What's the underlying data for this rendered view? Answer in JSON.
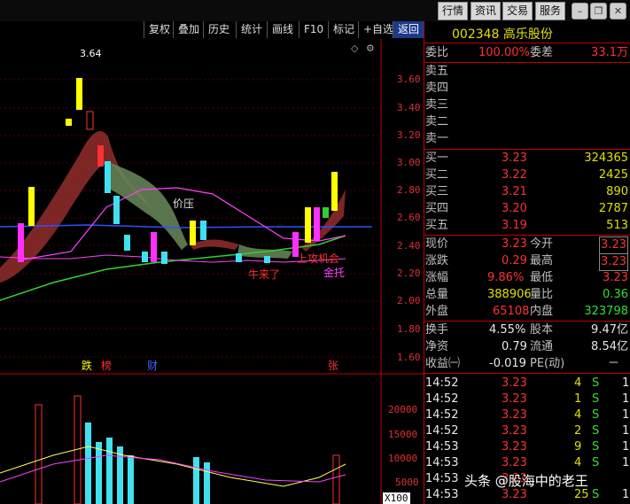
{
  "topbar": {
    "buttons": [
      "行情",
      "资讯",
      "交易",
      "服务"
    ]
  },
  "toolbar": {
    "items": [
      "复权",
      "叠加",
      "历史",
      "统计",
      "画线",
      "F10",
      "标记",
      "+自选",
      "返回"
    ]
  },
  "stock": {
    "code": "002348",
    "name": "高乐股份"
  },
  "weibi": {
    "label": "委比",
    "value": "100.00%",
    "label2": "委差",
    "value2": "33.1万"
  },
  "sell": [
    "卖五",
    "卖四",
    "卖三",
    "卖二",
    "卖一"
  ],
  "buy": [
    {
      "label": "买一",
      "price": "3.23",
      "vol": "324365"
    },
    {
      "label": "买二",
      "price": "3.22",
      "vol": "2425"
    },
    {
      "label": "买三",
      "price": "3.21",
      "vol": "890"
    },
    {
      "label": "买四",
      "price": "3.20",
      "vol": "2787"
    },
    {
      "label": "买五",
      "price": "3.19",
      "vol": "513"
    }
  ],
  "quote": [
    {
      "l1": "现价",
      "v1": "3.23",
      "l2": "今开",
      "v2": "3.23"
    },
    {
      "l1": "涨跌",
      "v1": "0.29",
      "l2": "最高",
      "v2": "3.23"
    },
    {
      "l1": "涨幅",
      "v1": "9.86%",
      "l2": "最低",
      "v2": "3.23"
    },
    {
      "l1": "总量",
      "v1": "388906",
      "l2": "量比",
      "v2": "0.36"
    },
    {
      "l1": "外盘",
      "v1": "65108",
      "l2": "内盘",
      "v2": "323798"
    }
  ],
  "fund": [
    {
      "l1": "换手",
      "v1": "4.55%",
      "l2": "股本",
      "v2": "9.47亿"
    },
    {
      "l1": "净资",
      "v1": "0.79",
      "l2": "流通",
      "v2": "8.54亿"
    },
    {
      "l1": "收益㈠",
      "v1": "-0.019",
      "l2": "PE(动)",
      "v2": "－"
    }
  ],
  "ticks": [
    {
      "time": "14:52",
      "price": "3.23",
      "vol": "4",
      "side": "S",
      "n": "1"
    },
    {
      "time": "14:52",
      "price": "3.23",
      "vol": "1",
      "side": "S",
      "n": "1"
    },
    {
      "time": "14:52",
      "price": "3.23",
      "vol": "4",
      "side": "S",
      "n": "1"
    },
    {
      "time": "14:52",
      "price": "3.23",
      "vol": "2",
      "side": "S",
      "n": "1"
    },
    {
      "time": "14:53",
      "price": "3.23",
      "vol": "9",
      "side": "S",
      "n": "1"
    },
    {
      "time": "14:53",
      "price": "3.23",
      "vol": "4",
      "side": "S",
      "n": "1"
    },
    {
      "time": "14:53",
      "price": "3.23",
      "vol": "",
      "side": "",
      "n": ""
    },
    {
      "time": "14:53",
      "price": "3.23",
      "vol": "25",
      "side": "S",
      "n": "1"
    }
  ],
  "chart_data": {
    "type": "candlestick",
    "price_axis": [
      "3.60",
      "3.40",
      "3.20",
      "3.00",
      "2.80",
      "2.60",
      "2.40",
      "2.20",
      "2.00",
      "1.80",
      "1.60"
    ],
    "volume_axis": [
      "20000",
      "15000",
      "10000",
      "5000",
      "X100"
    ],
    "high_label": "3.64",
    "annotations": [
      "价压",
      "上攻机会",
      "牛来了",
      "金托"
    ],
    "markers": [
      "跌",
      "榜",
      "财",
      "张"
    ],
    "colors": {
      "up": "#ff3030",
      "down": "#40e0f0",
      "limit": "#ffff00",
      "hot": "#ff30ff",
      "ma5": "#ffff60",
      "ma10": "#ff40ff",
      "ma20": "#3050ff",
      "ma60": "#30d030"
    }
  },
  "watermark": "头条 @股海中的老王"
}
